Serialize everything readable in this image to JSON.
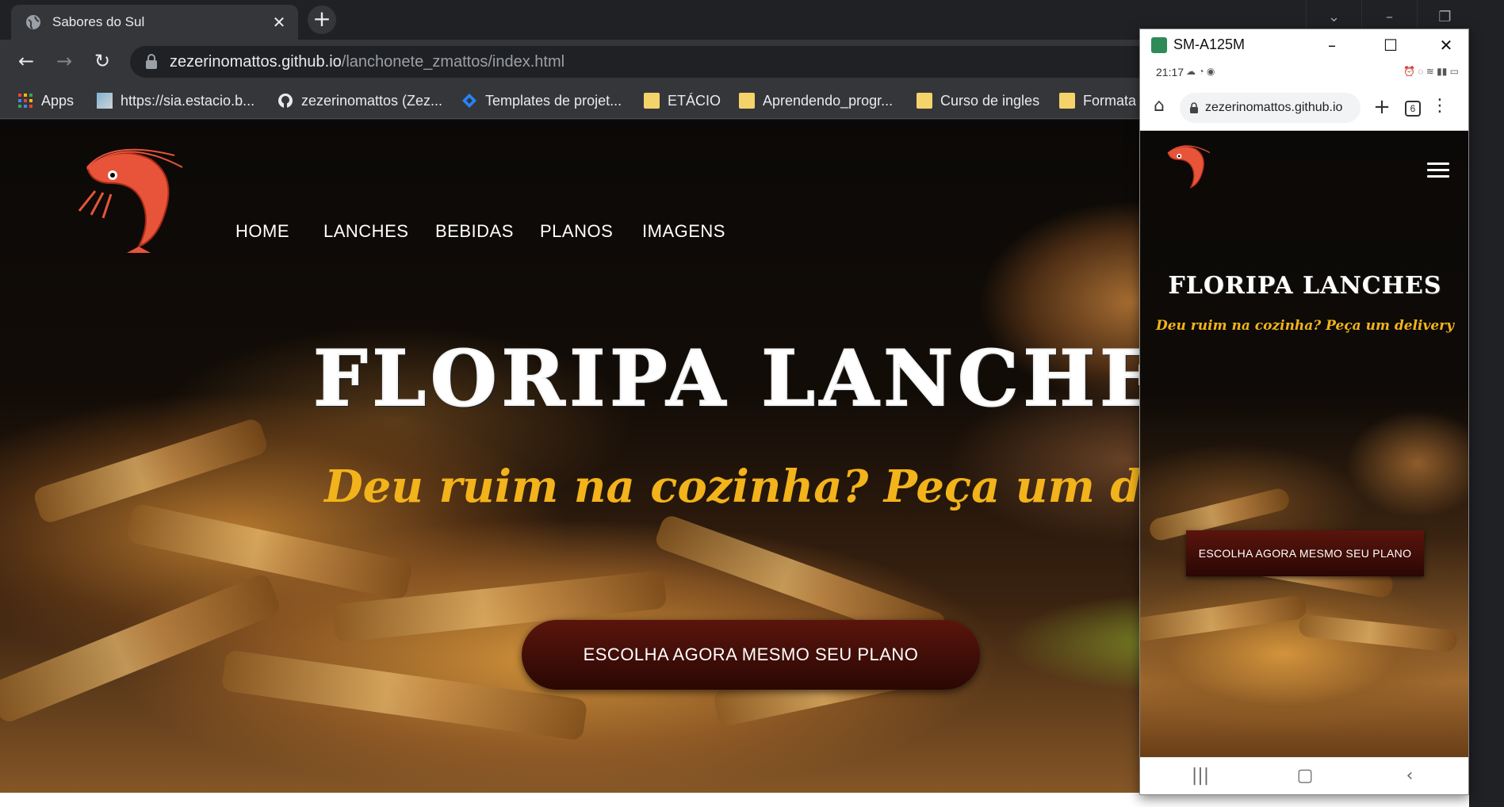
{
  "browser": {
    "tab_title": "Sabores do Sul",
    "tab_close": "✕",
    "new_tab": "+",
    "url_host": "zezerinomattos.github.io",
    "url_path": "/lanchonete_zmattos/index.html",
    "bookmarks": [
      {
        "label": "Apps",
        "icon": "apps-grid-icon"
      },
      {
        "label": "https://sia.estacio.b...",
        "icon": "estacio-icon"
      },
      {
        "label": "zezerinomattos (Zez...",
        "icon": "github-icon"
      },
      {
        "label": "Templates de projet...",
        "icon": "jira-icon"
      },
      {
        "label": "ETÁCIO",
        "icon": "folder-icon"
      },
      {
        "label": "Aprendendo_progr...",
        "icon": "folder-icon"
      },
      {
        "label": "Curso de ingles",
        "icon": "folder-icon"
      },
      {
        "label": "Formata",
        "icon": "folder-icon"
      }
    ],
    "more_bookmarks": "»"
  },
  "site": {
    "nav": [
      "HOME",
      "LANCHES",
      "BEBIDAS",
      "PLANOS",
      "IMAGENS"
    ],
    "title": "FLORIPA LANCHES",
    "subtitle": "Deu ruim na cozinha? Peça um delivery",
    "cta": "ESCOLHA AGORA MESMO SEU PLANO"
  },
  "phone": {
    "window_title": "SM-A125M",
    "time": "21:17",
    "url": "zezerinomattos.github.io",
    "tab_count": "6",
    "title": "FLORIPA LANCHES",
    "subtitle": "Deu ruim na cozinha? Peça um delivery",
    "cta": "ESCOLHA AGORA MESMO SEU PLANO"
  },
  "colors": {
    "accent_yellow": "#f2b31b",
    "cta_dark_red": "#4a100a",
    "chrome_dark": "#202124"
  }
}
